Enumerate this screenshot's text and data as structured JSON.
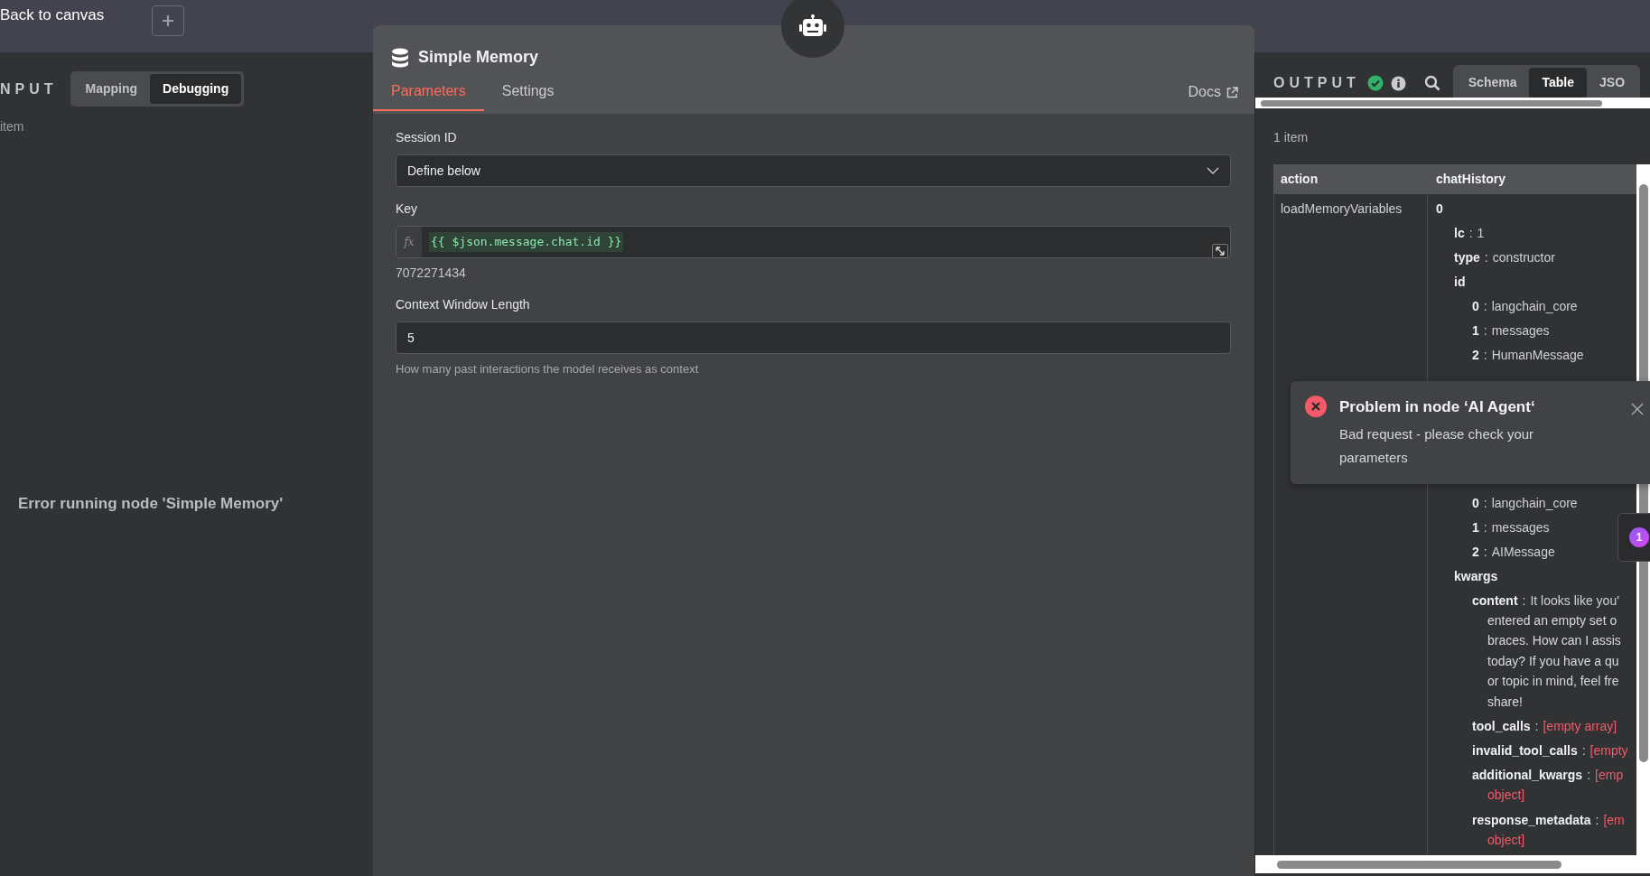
{
  "top_bar": {
    "back_link": "Back to canvas"
  },
  "input_panel": {
    "title": "NPUT",
    "modes": [
      {
        "label": "Mapping",
        "selected": false
      },
      {
        "label": "Debugging",
        "selected": true
      }
    ],
    "item_count": "item",
    "message": "Error running node 'Simple Memory'"
  },
  "node_dialog": {
    "title": "Simple Memory",
    "tabs": [
      {
        "label": "Parameters",
        "selected": true
      },
      {
        "label": "Settings",
        "selected": false
      }
    ],
    "docs_link": "Docs",
    "fields": [
      {
        "kind": "select",
        "label": "Session ID",
        "value": "Define below"
      },
      {
        "kind": "expression",
        "label": "Key",
        "prefix": "fx",
        "value": "{{ $json.message.chat.id }}",
        "result": "7072271434"
      },
      {
        "kind": "number",
        "label": "Context Window Length",
        "value": "5",
        "hint": "How many past interactions the model receives as context"
      }
    ]
  },
  "output_panel": {
    "title": "OUTPUT",
    "views": [
      {
        "label": "Schema",
        "selected": false
      },
      {
        "label": "Table",
        "selected": true
      },
      {
        "label": "JSO",
        "selected": false
      }
    ],
    "item_count": "1 item",
    "table": {
      "columns": [
        "action",
        "chatHistory"
      ],
      "key_separator": ":",
      "rows": [
        {
          "action": "loadMemoryVariables",
          "chat_history": [
            [
              {
                "key": "0",
                "children": [
                  {
                    "key": "lc",
                    "value_lines": [
                      "1"
                    ],
                    "kind": "text"
                  },
                  {
                    "key": "type",
                    "value_lines": [
                      "constructor"
                    ],
                    "kind": "text"
                  },
                  {
                    "key": "id",
                    "children": [
                      {
                        "key": "0",
                        "value_lines": [
                          "langchain_core"
                        ],
                        "kind": "text"
                      },
                      {
                        "key": "1",
                        "value_lines": [
                          "messages"
                        ],
                        "kind": "text"
                      },
                      {
                        "key": "2",
                        "value_lines": [
                          "HumanMessage"
                        ],
                        "kind": "text"
                      }
                    ]
                  }
                ]
              }
            ],
            [
              {
                "children": [
                  {
                    "children": [
                      {
                        "key": "0",
                        "value_lines": [
                          "langchain_core"
                        ],
                        "kind": "text"
                      },
                      {
                        "key": "1",
                        "value_lines": [
                          "messages"
                        ],
                        "kind": "text"
                      },
                      {
                        "key": "2",
                        "value_lines": [
                          "AIMessage"
                        ],
                        "kind": "text"
                      }
                    ]
                  },
                  {
                    "key": "kwargs",
                    "children": [
                      {
                        "key": "content",
                        "value_lines": [
                          "It looks like you'",
                          "entered an empty set o",
                          "braces. How can I assis",
                          "today? If you have a qu",
                          "or topic in mind, feel fre",
                          "share!"
                        ],
                        "kind": "text"
                      },
                      {
                        "key": "tool_calls",
                        "value_lines": [
                          "[empty array]"
                        ],
                        "kind": "empty"
                      },
                      {
                        "key": "invalid_tool_calls",
                        "value_lines": [
                          "[empty"
                        ],
                        "kind": "empty"
                      },
                      {
                        "key": "additional_kwargs",
                        "value_lines": [
                          "[emp",
                          "object]"
                        ],
                        "kind": "empty"
                      },
                      {
                        "key": "response_metadata",
                        "value_lines": [
                          "[em",
                          "object]"
                        ],
                        "kind": "empty"
                      }
                    ]
                  }
                ]
              }
            ]
          ]
        }
      ]
    }
  },
  "toast": {
    "title": "Problem in node ‘AI Agent‘",
    "message": "Bad request - please check your parameters"
  },
  "side_badge": "1"
}
